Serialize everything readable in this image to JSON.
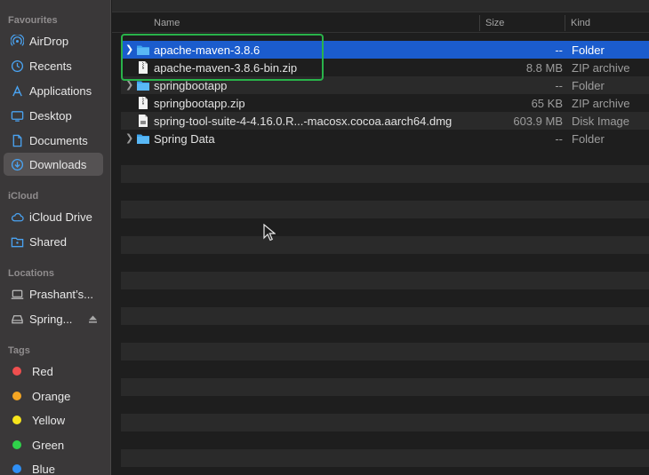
{
  "sidebar": {
    "favourites_heading": "Favourites",
    "favourites": [
      {
        "label": "AirDrop",
        "icon": "airdrop-icon"
      },
      {
        "label": "Recents",
        "icon": "clock-icon"
      },
      {
        "label": "Applications",
        "icon": "applications-icon"
      },
      {
        "label": "Desktop",
        "icon": "desktop-icon"
      },
      {
        "label": "Documents",
        "icon": "document-icon"
      },
      {
        "label": "Downloads",
        "icon": "download-icon",
        "active": true
      }
    ],
    "icloud_heading": "iCloud",
    "icloud": [
      {
        "label": "iCloud Drive",
        "icon": "cloud-icon"
      },
      {
        "label": "Shared",
        "icon": "shared-folder-icon"
      }
    ],
    "locations_heading": "Locations",
    "locations": [
      {
        "label": "Prashant’s...",
        "icon": "laptop-icon"
      },
      {
        "label": "Spring...",
        "icon": "disk-icon",
        "ejectable": true
      }
    ],
    "tags_heading": "Tags",
    "tags": [
      {
        "label": "Red",
        "color": "#ef4f4f"
      },
      {
        "label": "Orange",
        "color": "#f5a623"
      },
      {
        "label": "Yellow",
        "color": "#f7e51c"
      },
      {
        "label": "Green",
        "color": "#2fd24a"
      },
      {
        "label": "Blue",
        "color": "#2f8ff5"
      }
    ]
  },
  "columns": {
    "name": "Name",
    "size": "Size",
    "kind": "Kind"
  },
  "files": [
    {
      "name": "apache-maven-3.8.6",
      "size": "--",
      "kind": "Folder",
      "type": "folder",
      "expandable": true,
      "selected": true
    },
    {
      "name": "apache-maven-3.8.6-bin.zip",
      "size": "8.8 MB",
      "kind": "ZIP archive",
      "type": "file"
    },
    {
      "name": "springbootapp",
      "size": "--",
      "kind": "Folder",
      "type": "folder",
      "expandable": true
    },
    {
      "name": "springbootapp.zip",
      "size": "65 KB",
      "kind": "ZIP archive",
      "type": "file"
    },
    {
      "name": "spring-tool-suite-4-4.16.0.R...-macosx.cocoa.aarch64.dmg",
      "size": "603.9 MB",
      "kind": "Disk Image",
      "type": "file"
    },
    {
      "name": "Spring Data",
      "size": "--",
      "kind": "Folder",
      "type": "folder",
      "expandable": true
    }
  ],
  "colors": {
    "selection": "#1b5ccd",
    "folder": "#3ea6f0",
    "highlight_box": "#29b34a"
  }
}
